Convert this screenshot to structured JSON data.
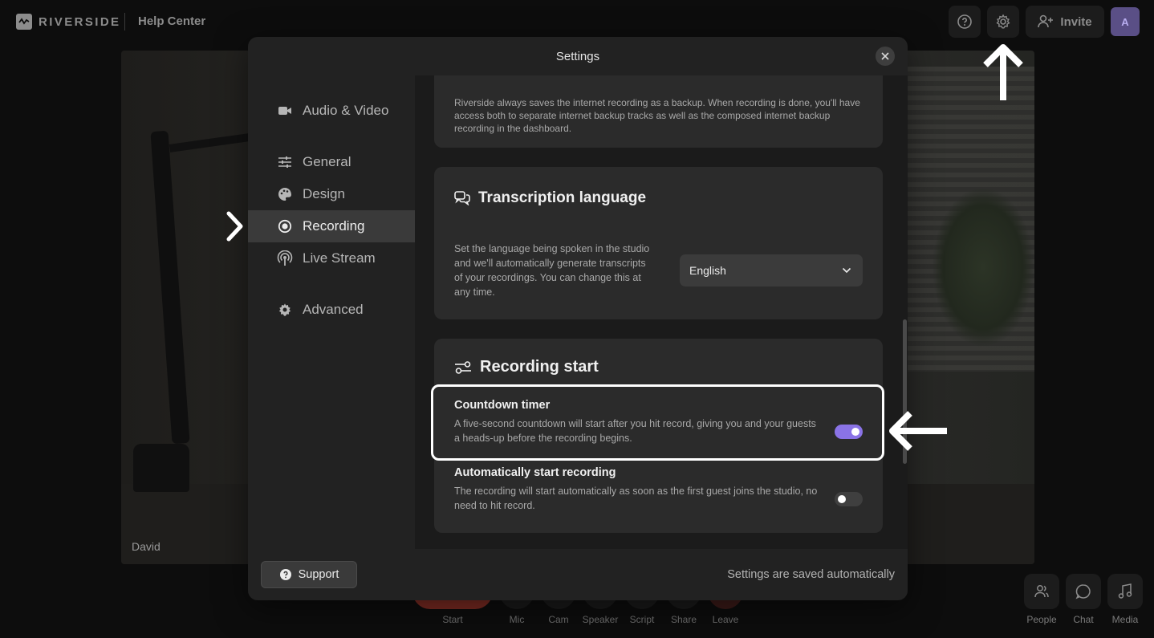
{
  "topbar": {
    "brand": "RIVERSIDE",
    "help_center": "Help Center",
    "invite_label": "Invite",
    "avatar_initial": "A"
  },
  "video": {
    "participant_name": "David"
  },
  "controls": [
    {
      "label": "Start"
    },
    {
      "label": "Mic"
    },
    {
      "label": "Cam"
    },
    {
      "label": "Speaker"
    },
    {
      "label": "Script"
    },
    {
      "label": "Share"
    },
    {
      "label": "Leave"
    }
  ],
  "side_controls": [
    {
      "label": "People",
      "icon": "people-icon"
    },
    {
      "label": "Chat",
      "icon": "chat-icon"
    },
    {
      "label": "Media",
      "icon": "music-note-icon"
    }
  ],
  "modal": {
    "title": "Settings",
    "nav": [
      {
        "label": "Audio & Video",
        "icon": "video-camera-icon"
      },
      {
        "label": "General",
        "icon": "sliders-icon"
      },
      {
        "label": "Design",
        "icon": "palette-icon"
      },
      {
        "label": "Recording",
        "icon": "record-icon",
        "active": true
      },
      {
        "label": "Live Stream",
        "icon": "broadcast-icon"
      },
      {
        "label": "Advanced",
        "icon": "gear-icon"
      }
    ],
    "backup_text": "Riverside always saves the internet recording as a backup. When recording is done, you'll have access both to separate internet backup tracks as well as the composed internet backup recording in the dashboard.",
    "transcription": {
      "heading": "Transcription language",
      "description": "Set the language being spoken in the studio and we'll automatically generate transcripts of your recordings. You can change this at any time.",
      "selected_language": "English"
    },
    "recording_start": {
      "heading": "Recording start",
      "countdown": {
        "title": "Countdown timer",
        "description": "A five-second countdown will start after you hit record, giving you and your guests a heads-up before the recording begins.",
        "enabled": true
      },
      "auto_start": {
        "title": "Automatically start recording",
        "description": "The recording will start automatically as soon as the first guest joins the studio, no need to hit record.",
        "enabled": false
      }
    },
    "support_label": "Support",
    "saved_note": "Settings are saved automatically"
  },
  "colors": {
    "accent": "#8a73e6",
    "avatar_bg": "#5a4f86",
    "modal_bg": "#222222",
    "card_bg": "#2b2b2b"
  }
}
